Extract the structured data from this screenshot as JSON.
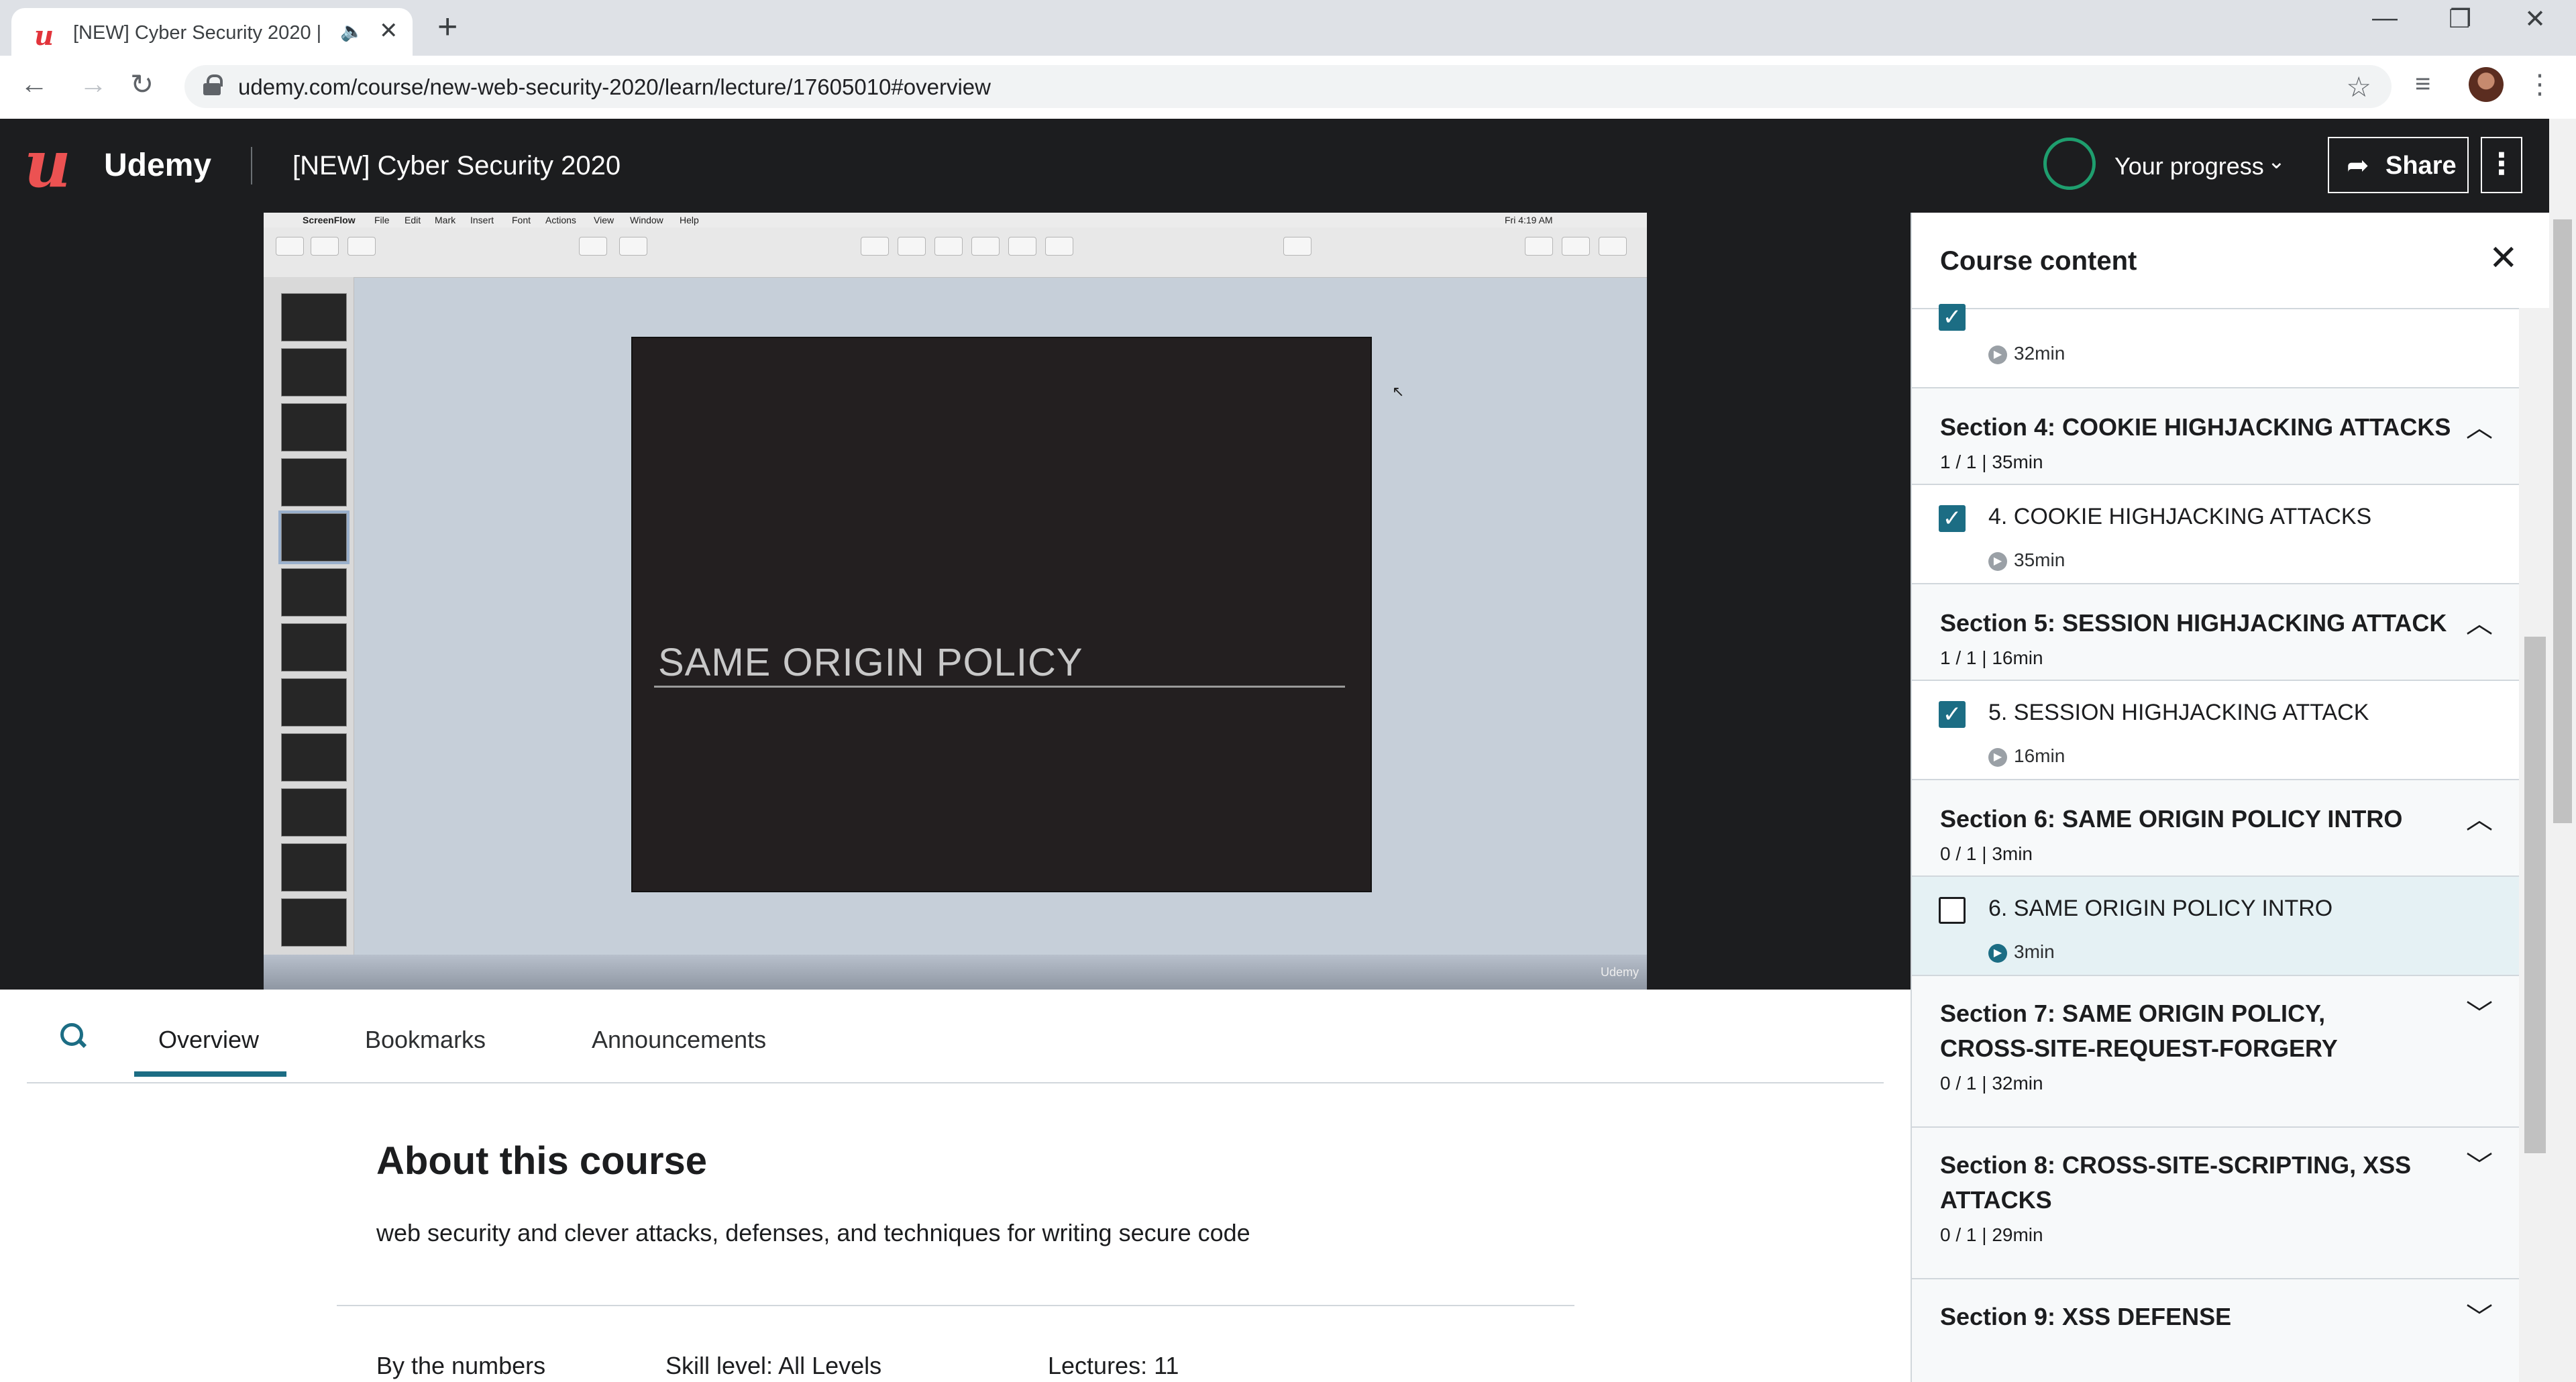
{
  "browser": {
    "tab_title": "[NEW] Cyber Security 2020 |",
    "url": "udemy.com/course/new-web-security-2020/learn/lecture/17605010#overview",
    "new_tab": "+",
    "close": "✕",
    "minimize": "—",
    "restore": "❐",
    "win_close": "✕"
  },
  "header": {
    "brand": "Udemy",
    "course_title": "[NEW] Cyber Security 2020",
    "progress_label": "Your progress",
    "share_label": "Share"
  },
  "video": {
    "slide_title": "SAME ORIGIN POLICY",
    "menubar": [
      "ScreenFlow",
      "File",
      "Edit",
      "Mark",
      "Insert",
      "Font",
      "Actions",
      "View",
      "Window",
      "Help"
    ],
    "clock": "Fri 4:19 AM",
    "watermark": "Udemy"
  },
  "tabs": {
    "overview": "Overview",
    "bookmarks": "Bookmarks",
    "announcements": "Announcements"
  },
  "about": {
    "title": "About this course",
    "description": "web security and clever attacks, defenses, and techniques for writing secure code",
    "by_numbers": "By the numbers",
    "skill_level": "Skill level: All Levels",
    "lectures": "Lectures: 11"
  },
  "course_content": {
    "title": "Course content",
    "prev_item_duration": "32min",
    "sections": [
      {
        "title": "Section 4: COOKIE HIGHJACKING ATTACKS",
        "meta": "1 / 1 | 35min",
        "item": "4. COOKIE HIGHJACKING ATTACKS",
        "duration": "35min"
      },
      {
        "title": "Section 5: SESSION HIGHJACKING ATTACK",
        "meta": "1 / 1 | 16min",
        "item": "5. SESSION HIGHJACKING ATTACK",
        "duration": "16min"
      },
      {
        "title": "Section 6: SAME ORIGIN POLICY INTRO",
        "meta": "0 / 1 | 3min",
        "item": "6. SAME ORIGIN POLICY INTRO",
        "duration": "3min"
      },
      {
        "title": "Section 7: SAME ORIGIN POLICY,",
        "title2": "CROSS-SITE-REQUEST-FORGERY",
        "meta": "0 / 1 | 32min"
      },
      {
        "title": "Section 8: CROSS-SITE-SCRIPTING, XSS",
        "title2": "ATTACKS",
        "meta": "0 / 1 | 29min"
      },
      {
        "title": "Section 9: XSS DEFENSE"
      }
    ]
  }
}
